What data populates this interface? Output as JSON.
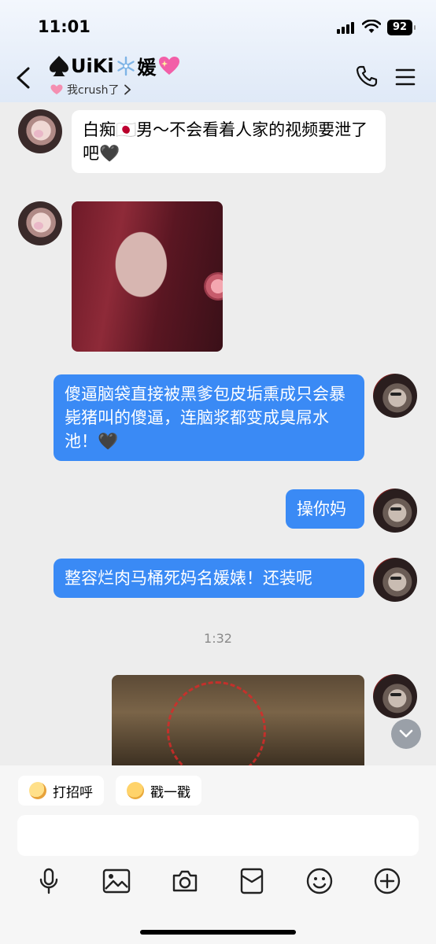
{
  "status": {
    "time": "11:01",
    "battery": "92"
  },
  "header": {
    "title_text": "UiKi",
    "title_suffix": "媛",
    "subtitle": "我crush了",
    "title_prefix_icon": "spade-icon",
    "title_mid_icon": "snowflake-icon",
    "title_end_icon": "sparkling-heart-icon"
  },
  "messages": [
    {
      "side": "in",
      "type": "text",
      "text": "白痴🇯🇵男～不会看着人家的视频要泄了吧🖤"
    },
    {
      "side": "in",
      "type": "image",
      "icon": "selfie-photo"
    },
    {
      "side": "out",
      "type": "text",
      "text": "傻逼脑袋直接被黑爹包皮垢熏成只会暴毙猪叫的傻逼，连脑浆都变成臭屌水池！🖤"
    },
    {
      "side": "out",
      "type": "text",
      "text": "操你妈"
    },
    {
      "side": "out",
      "type": "text",
      "text": "整容烂肉马桶死妈名媛婊！还装呢"
    },
    {
      "side": "out",
      "type": "image",
      "icon": "room-photo"
    }
  ],
  "timestamp": "1:32",
  "quick_actions": [
    {
      "label": "打招呼",
      "icon": "wave-emoji-icon"
    },
    {
      "label": "戳一戳",
      "icon": "poke-emoji-icon"
    }
  ],
  "input": {
    "placeholder": ""
  },
  "toolbar": [
    "microphone-icon",
    "image-icon",
    "camera-icon",
    "red-packet-icon",
    "emoji-icon",
    "plus-icon"
  ],
  "colors": {
    "accent": "#3a8af5",
    "background": "#ededed",
    "header": "#e3ecf8"
  }
}
